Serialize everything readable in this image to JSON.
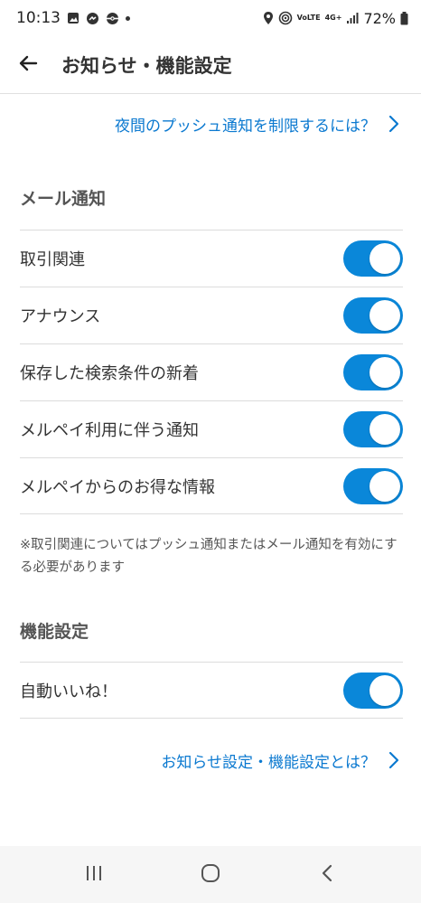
{
  "status_bar": {
    "time": "10:13",
    "network": "4G+",
    "volte": "VoLTE",
    "battery": "72%"
  },
  "header": {
    "title": "お知らせ・機能設定",
    "back_icon": "arrow-left-icon"
  },
  "push_limit_link": "夜間のプッシュ通知を制限するには？",
  "mail_section": {
    "heading": "メール通知",
    "items": [
      {
        "label": "取引関連",
        "enabled": true
      },
      {
        "label": "アナウンス",
        "enabled": true
      },
      {
        "label": "保存した検索条件の新着",
        "enabled": true
      },
      {
        "label": "メルペイ利用に伴う通知",
        "enabled": true
      },
      {
        "label": "メルペイからのお得な情報",
        "enabled": true
      }
    ],
    "note": "※取引関連についてはプッシュ通知またはメール通知を有効にする必要があります"
  },
  "feature_section": {
    "heading": "機能設定",
    "items": [
      {
        "label": "自動いいね！",
        "enabled": true
      }
    ]
  },
  "about_link": "お知らせ設定・機能設定とは？",
  "colors": {
    "accent": "#0a87d9",
    "link": "#0b79d0"
  }
}
